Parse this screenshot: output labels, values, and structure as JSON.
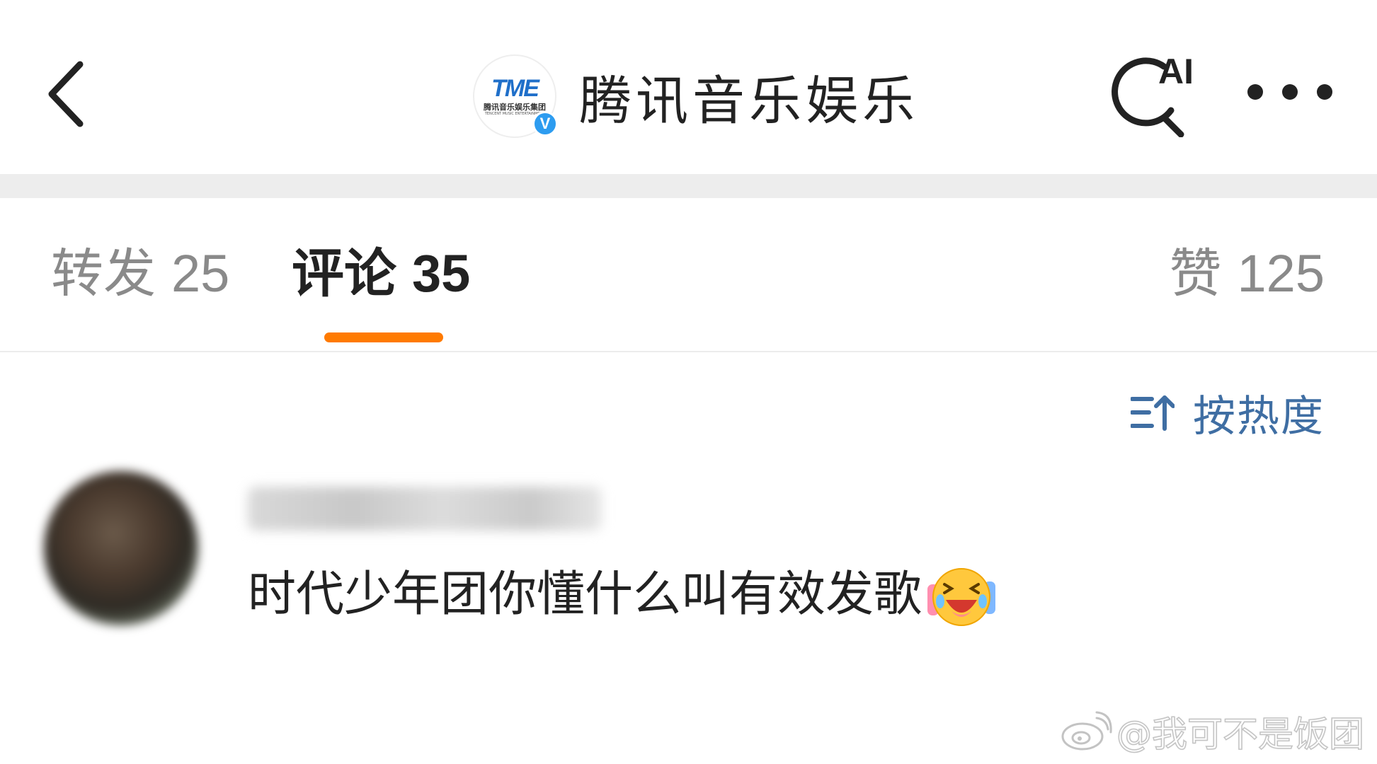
{
  "header": {
    "title": "腾讯音乐娱乐",
    "logo": {
      "mark": "TME",
      "subtitle": "腾讯音乐娱乐集团",
      "subtitle_en": "TENCENT MUSIC ENTERTAINMENT",
      "verified_badge": "V"
    },
    "ai_label": "AI",
    "icons": {
      "back": "chevron-left-icon",
      "ai_search": "ai-search-icon",
      "more": "more-horizontal-icon"
    }
  },
  "tabs": [
    {
      "label": "转发",
      "count": "25",
      "active": false
    },
    {
      "label": "评论",
      "count": "35",
      "active": true
    },
    {
      "label": "赞",
      "count": "125",
      "active": false
    }
  ],
  "accent_color": "#ff7a00",
  "link_color": "#3f6ea3",
  "sort": {
    "label": "按热度",
    "icon": "sort-ascending-icon"
  },
  "comments": [
    {
      "username": "",
      "text": "时代少年团你懂什么叫有效发歌",
      "emoji": "laughing-crying-emoji"
    }
  ],
  "watermark": {
    "text": "@我可不是饭团",
    "icon": "weibo-logo"
  }
}
